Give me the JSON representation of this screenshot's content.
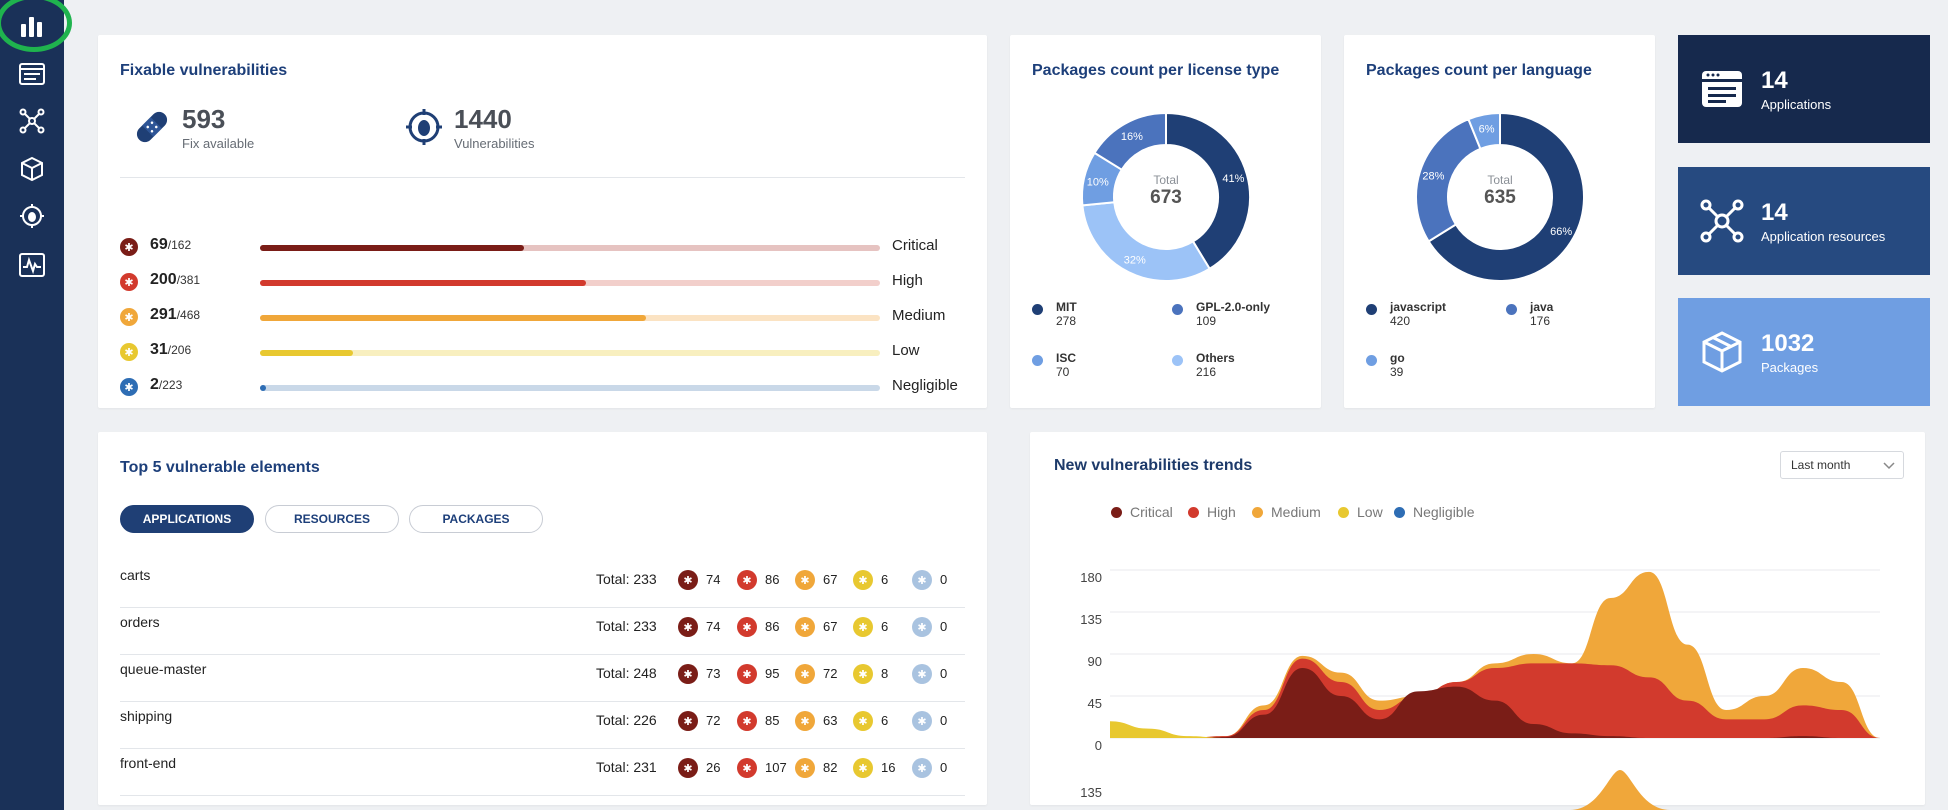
{
  "sidebar": {
    "items": [
      {
        "name": "dashboard",
        "icon": "bar-chart-icon"
      },
      {
        "name": "applications",
        "icon": "window-icon"
      },
      {
        "name": "resources",
        "icon": "network-icon"
      },
      {
        "name": "packages",
        "icon": "box-icon"
      },
      {
        "name": "vulnerabilities",
        "icon": "bug-target-icon"
      },
      {
        "name": "monitor",
        "icon": "activity-icon"
      }
    ]
  },
  "fixable": {
    "title": "Fixable vulnerabilities",
    "fix_count": "593",
    "fix_label": "Fix available",
    "vuln_count": "1440",
    "vuln_label": "Vulnerabilities",
    "rows": [
      {
        "count": "69",
        "total": "/162",
        "label": "Critical",
        "fraction": 0.426,
        "color": "#7a1d17",
        "track": "#e6c3c1"
      },
      {
        "count": "200",
        "total": "/381",
        "label": "High",
        "fraction": 0.525,
        "color": "#d23a2d",
        "track": "#f2cfcb"
      },
      {
        "count": "291",
        "total": "/468",
        "label": "Medium",
        "fraction": 0.622,
        "color": "#f0a73a",
        "track": "#fbe3c3"
      },
      {
        "count": "31",
        "total": "/206",
        "label": "Low",
        "fraction": 0.15,
        "color": "#e8c830",
        "track": "#f8efbf"
      },
      {
        "count": "2",
        "total": "/223",
        "label": "Negligible",
        "fraction": 0.009,
        "color": "#2e6db4",
        "track": "#c9d8e8"
      }
    ]
  },
  "license": {
    "title": "Packages count per license type",
    "total_label": "Total",
    "total": "673",
    "slices": [
      {
        "name": "MIT",
        "value": 278,
        "pct": "41%",
        "color": "#1f3f75"
      },
      {
        "name": "Others",
        "value": 216,
        "pct": "32%",
        "color": "#9cc3f7"
      },
      {
        "name": "ISC",
        "value": 70,
        "pct": "10%",
        "color": "#6f9ee2"
      },
      {
        "name": "GPL-2.0-only",
        "value": 109,
        "pct": "16%",
        "color": "#4b73bd"
      }
    ],
    "legend": [
      {
        "name": "MIT",
        "value": "278",
        "color": "#1f3f75"
      },
      {
        "name": "GPL-2.0-only",
        "value": "109",
        "color": "#4b73bd"
      },
      {
        "name": "ISC",
        "value": "70",
        "color": "#6f9ee2"
      },
      {
        "name": "Others",
        "value": "216",
        "color": "#9cc3f7"
      }
    ]
  },
  "language": {
    "title": "Packages count per language",
    "total_label": "Total",
    "total": "635",
    "slices": [
      {
        "name": "javascript",
        "value": 420,
        "pct": "66%",
        "color": "#1f3f75"
      },
      {
        "name": "java",
        "value": 176,
        "pct": "28%",
        "color": "#4b73bd"
      },
      {
        "name": "go",
        "value": 39,
        "pct": "6%",
        "color": "#6f9ee2"
      }
    ],
    "legend": [
      {
        "name": "javascript",
        "value": "420",
        "color": "#1f3f75"
      },
      {
        "name": "java",
        "value": "176",
        "color": "#4b73bd"
      },
      {
        "name": "go",
        "value": "39",
        "color": "#6f9ee2"
      }
    ]
  },
  "stats": [
    {
      "value": "14",
      "label": "Applications",
      "icon": "window-icon",
      "color": "#16294d"
    },
    {
      "value": "14",
      "label": "Application resources",
      "icon": "network-icon",
      "color": "#264a80"
    },
    {
      "value": "1032",
      "label": "Packages",
      "icon": "box-icon",
      "color": "#6f9ee2"
    }
  ],
  "top5": {
    "title": "Top 5 vulnerable elements",
    "tabs": [
      "APPLICATIONS",
      "RESOURCES",
      "PACKAGES"
    ],
    "rows": [
      {
        "name": "carts",
        "total": "Total: 233",
        "counts": [
          "74",
          "86",
          "67",
          "6",
          "0"
        ]
      },
      {
        "name": "orders",
        "total": "Total: 233",
        "counts": [
          "74",
          "86",
          "67",
          "6",
          "0"
        ]
      },
      {
        "name": "queue-master",
        "total": "Total: 248",
        "counts": [
          "73",
          "95",
          "72",
          "8",
          "0"
        ]
      },
      {
        "name": "shipping",
        "total": "Total: 226",
        "counts": [
          "72",
          "85",
          "63",
          "6",
          "0"
        ]
      },
      {
        "name": "front-end",
        "total": "Total: 231",
        "counts": [
          "26",
          "107",
          "82",
          "16",
          "0"
        ]
      }
    ]
  },
  "severity_colors": [
    "#7a1d17",
    "#d23a2d",
    "#f0a73a",
    "#e8c830",
    "#a9c3e0"
  ],
  "trends": {
    "title": "New vulnerabilities trends",
    "range_select": "Last month",
    "legend": [
      {
        "name": "Critical",
        "color": "#7a1d17"
      },
      {
        "name": "High",
        "color": "#d23a2d"
      },
      {
        "name": "Medium",
        "color": "#f0a73a"
      },
      {
        "name": "Low",
        "color": "#e8c830"
      },
      {
        "name": "Negligible",
        "color": "#2e6db4"
      }
    ],
    "yticks": [
      "180",
      "135",
      "90",
      "45",
      "0"
    ],
    "lower_tick": "135"
  },
  "chart_data": {
    "type": "area",
    "title": "New vulnerabilities trends",
    "ylim": [
      0,
      180
    ],
    "yticks": [
      0,
      45,
      90,
      135,
      180
    ],
    "x": [
      0,
      1,
      2,
      3,
      4,
      5,
      6,
      7,
      8,
      9,
      10,
      11,
      12,
      13,
      14,
      15,
      16,
      17,
      18,
      19,
      20
    ],
    "series": [
      {
        "name": "Medium",
        "values": [
          0,
          0,
          0,
          2,
          35,
          88,
          70,
          40,
          45,
          60,
          80,
          90,
          80,
          150,
          178,
          100,
          30,
          45,
          75,
          60,
          0
        ]
      },
      {
        "name": "High",
        "values": [
          0,
          0,
          0,
          2,
          30,
          85,
          60,
          30,
          45,
          60,
          75,
          80,
          80,
          78,
          65,
          40,
          20,
          20,
          35,
          30,
          0
        ]
      },
      {
        "name": "Critical",
        "values": [
          0,
          0,
          0,
          1,
          25,
          75,
          45,
          20,
          50,
          55,
          40,
          15,
          5,
          2,
          0,
          0,
          0,
          0,
          2,
          0,
          0
        ]
      },
      {
        "name": "Low",
        "values": [
          18,
          10,
          2,
          0,
          0,
          0,
          0,
          0,
          0,
          0,
          0,
          0,
          0,
          0,
          0,
          0,
          0,
          0,
          0,
          0,
          0
        ]
      }
    ]
  }
}
